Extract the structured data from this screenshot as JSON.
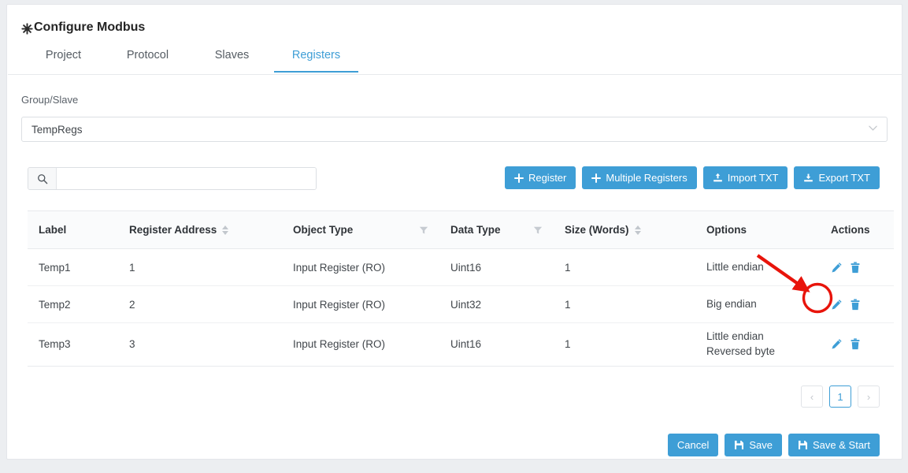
{
  "header": {
    "title": "Configure Modbus",
    "title_icon": "gear-icon"
  },
  "tabs": [
    {
      "label": "Project",
      "active": false
    },
    {
      "label": "Protocol",
      "active": false
    },
    {
      "label": "Slaves",
      "active": false
    },
    {
      "label": "Registers",
      "active": true
    }
  ],
  "group_slave": {
    "label": "Group/Slave",
    "value": "TempRegs",
    "chevron_icon": "chevron-down-icon"
  },
  "search": {
    "icon": "search-icon",
    "value": "",
    "placeholder": ""
  },
  "toolbar": {
    "register_label": "Register",
    "multiple_registers_label": "Multiple Registers",
    "import_txt_label": "Import TXT",
    "export_txt_label": "Export TXT",
    "plus_icon": "plus-icon",
    "import_icon": "upload-icon",
    "export_icon": "download-icon"
  },
  "table": {
    "columns": [
      {
        "label": "Label",
        "sortable": false,
        "filterable": false
      },
      {
        "label": "Register Address",
        "sortable": true,
        "filterable": false
      },
      {
        "label": "Object Type",
        "sortable": false,
        "filterable": true
      },
      {
        "label": "Data Type",
        "sortable": false,
        "filterable": true
      },
      {
        "label": "Size (Words)",
        "sortable": true,
        "filterable": false
      },
      {
        "label": "Options",
        "sortable": false,
        "filterable": false
      },
      {
        "label": "Actions",
        "sortable": false,
        "filterable": false
      }
    ],
    "rows": [
      {
        "label": "Temp1",
        "register_address": "1",
        "object_type": "Input Register (RO)",
        "data_type": "Uint16",
        "size_words": "1",
        "options": [
          "Little endian"
        ]
      },
      {
        "label": "Temp2",
        "register_address": "2",
        "object_type": "Input Register (RO)",
        "data_type": "Uint32",
        "size_words": "1",
        "options": [
          "Big endian"
        ]
      },
      {
        "label": "Temp3",
        "register_address": "3",
        "object_type": "Input Register (RO)",
        "data_type": "Uint16",
        "size_words": "1",
        "options": [
          "Little endian",
          "Reversed byte"
        ]
      }
    ],
    "row_action_icons": {
      "edit": "pencil-icon",
      "delete": "trash-icon"
    }
  },
  "pagination": {
    "prev_label": "‹",
    "next_label": "›",
    "pages": [
      "1"
    ],
    "current": "1"
  },
  "footer": {
    "cancel_label": "Cancel",
    "save_label": "Save",
    "save_start_label": "Save & Start",
    "save_icon": "floppy-disk-icon"
  },
  "annotation": {
    "arrow_color": "#e8140b",
    "circle_color": "#e8140b",
    "target": "edit-icon-row-2"
  },
  "colors": {
    "accent": "#3e9ed6",
    "page_bg": "#eceef1",
    "card_bg": "#ffffff",
    "text": "#41464b",
    "border": "#e8eaed"
  }
}
